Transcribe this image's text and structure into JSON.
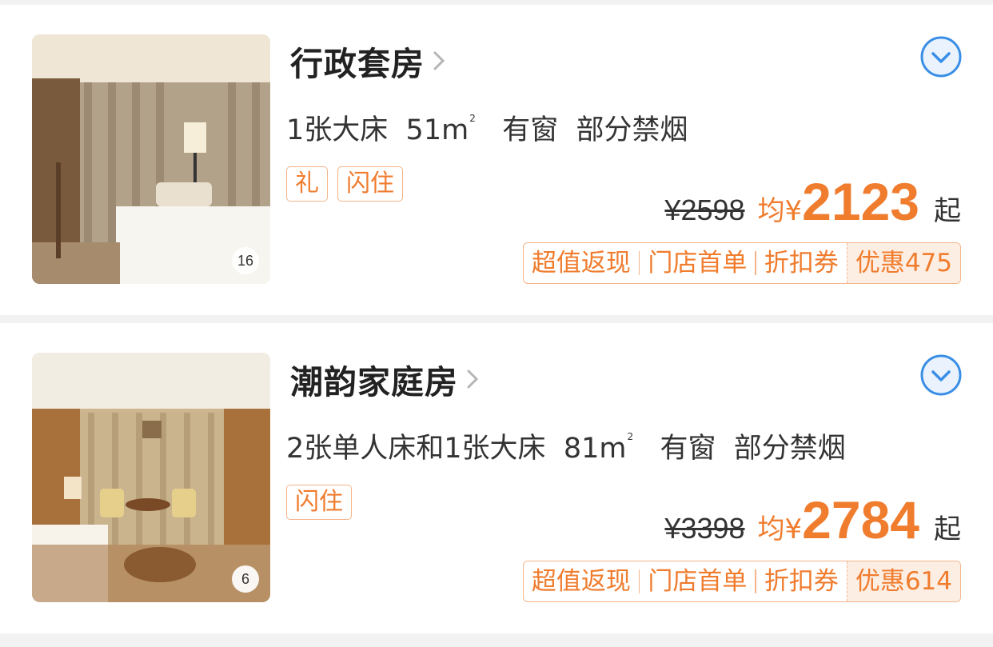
{
  "rooms": [
    {
      "name": "行政套房",
      "specs": {
        "bed": "1张大床",
        "area": "51m",
        "area_sup": "2",
        "window": "有窗",
        "smoking": "部分禁烟"
      },
      "photo_count": "16",
      "tags": [
        "礼",
        "闪住"
      ],
      "original_price": "¥2598",
      "avg_label": "均¥",
      "price": "2123",
      "price_suffix": "起",
      "promos": [
        "超值返现",
        "门店首单",
        "折扣券"
      ],
      "discount": "优惠475"
    },
    {
      "name": "潮韵家庭房",
      "specs": {
        "bed": "2张单人床和1张大床",
        "area": "81m",
        "area_sup": "2",
        "window": "有窗",
        "smoking": "部分禁烟"
      },
      "photo_count": "6",
      "tags": [
        "闪住"
      ],
      "original_price": "¥3398",
      "avg_label": "均¥",
      "price": "2784",
      "price_suffix": "起",
      "promos": [
        "超值返现",
        "门店首单",
        "折扣券"
      ],
      "discount": "优惠614"
    }
  ],
  "colors": {
    "accent": "#f07c2e",
    "tag_border": "#f4b48a",
    "expand_icon": "#3a8ee6"
  },
  "icons": {
    "expand": "chevron-down-circle-icon",
    "title_arrow": "chevron-right-icon"
  }
}
